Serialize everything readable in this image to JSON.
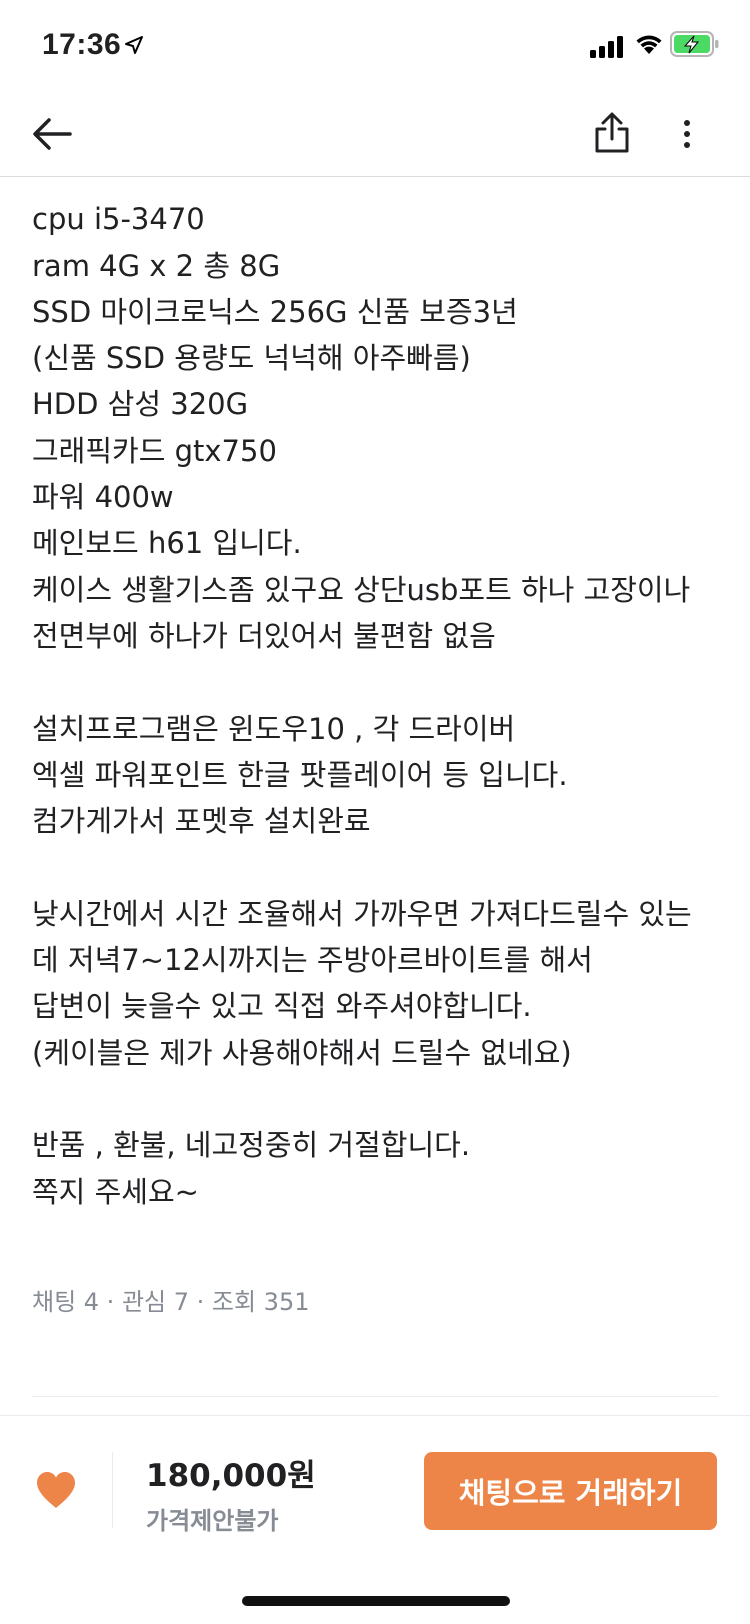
{
  "status_bar": {
    "time": "17:36",
    "icons": [
      "location-arrow-icon",
      "signal-icon",
      "wifi-icon",
      "battery-charging-icon"
    ]
  },
  "nav": {
    "icons": [
      "back-arrow-icon",
      "share-icon",
      "more-vertical-icon"
    ]
  },
  "description": {
    "lines": [
      "",
      "cpu  i5-3470",
      "ram 4G x 2 총 8G",
      "SSD 마이크로닉스 256G 신품 보증3년",
      "(신품 SSD 용량도 넉넉해 아주빠름)",
      "HDD 삼성 320G",
      "그래픽카드 gtx750",
      "파워 400w",
      "메인보드 h61  입니다.",
      "케이스 생활기스좀 있구요 상단usb포트 하나 고장이나",
      "전면부에 하나가 더있어서 불편함 없음",
      "",
      "설치프로그램은 윈도우10 , 각 드라이버",
      "엑셀 파워포인트 한글 팟플레이어 등 입니다.",
      "컴가게가서 포멧후 설치완료",
      "",
      "낮시간에서 시간 조율해서 가까우면 가져다드릴수 있는",
      "데 저녁7~12시까지는 주방아르바이트를 해서",
      "답변이 늦을수 있고 직접 와주셔야합니다.",
      "(케이블은 제가 사용해야해서 드릴수 없네요)",
      "",
      "반품 , 환불, 네고정중히 거절합니다.",
      "쪽지 주세요~"
    ]
  },
  "stats": "채팅 4 · 관심 7 · 조회 351",
  "bottom_bar": {
    "like_icon": "heart-icon",
    "price": "180,000원",
    "price_note": "가격제안불가",
    "chat_button_label": "채팅으로 거래하기"
  },
  "colors": {
    "accent": "#ee8548",
    "text": "#212124",
    "muted": "#868b94",
    "divider": "#e9ecef",
    "battery_green": "#4cd964"
  }
}
